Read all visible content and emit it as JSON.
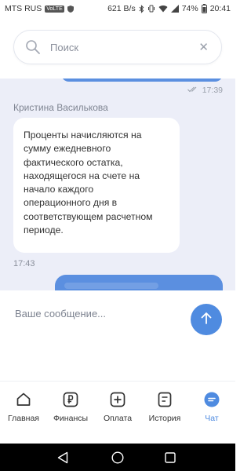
{
  "status_bar": {
    "carrier": "MTS RUS",
    "volte": "VoLTE",
    "speed": "621 B/s",
    "battery": "74%",
    "time": "20:41"
  },
  "search": {
    "placeholder": "Поиск"
  },
  "chat": {
    "outgoing_top": {
      "time": "17:39",
      "status": "read"
    },
    "incoming": {
      "sender": "Кристина Василькова",
      "lines": [
        "Проценты начисляются на",
        "сумму ежедневного",
        "фактического остатка,",
        "находящегося на счете на",
        "начало каждого",
        "операционного дня в",
        "соответствующем расчетном",
        "периоде."
      ],
      "time": "17:43"
    }
  },
  "composer": {
    "placeholder": "Ваше сообщение..."
  },
  "tabs": [
    {
      "label": "Главная",
      "icon": "home-icon"
    },
    {
      "label": "Финансы",
      "icon": "ruble-icon"
    },
    {
      "label": "Оплата",
      "icon": "plus-icon"
    },
    {
      "label": "История",
      "icon": "history-icon"
    },
    {
      "label": "Чат",
      "icon": "chat-icon",
      "active": true
    }
  ],
  "colors": {
    "accent": "#4f8be0",
    "chat_bg": "#eceef8",
    "outgoing_bubble": "#5b8fe0"
  }
}
